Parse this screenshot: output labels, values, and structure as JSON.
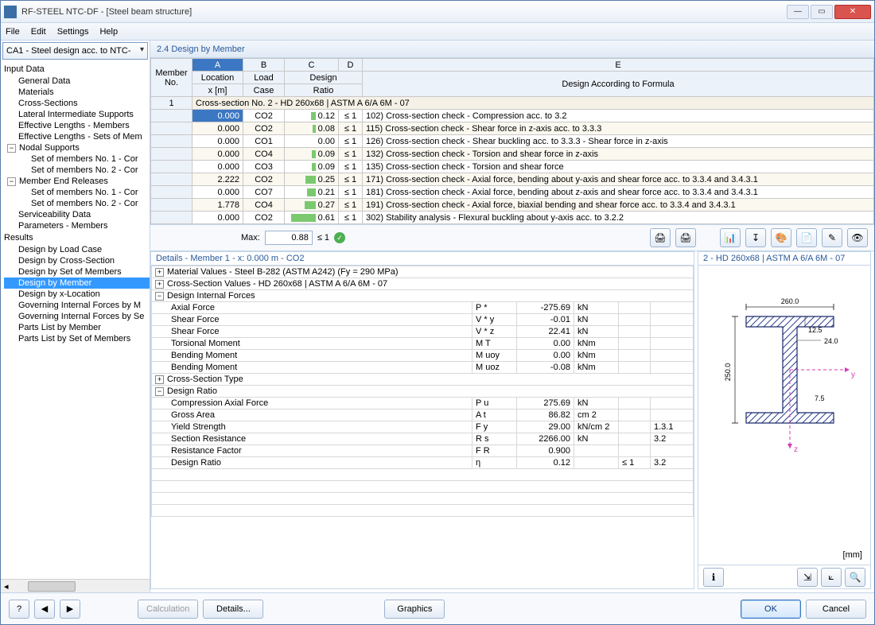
{
  "window": {
    "title": "RF-STEEL NTC-DF - [Steel beam structure]"
  },
  "menu": {
    "file": "File",
    "edit": "Edit",
    "settings": "Settings",
    "help": "Help"
  },
  "combo": "CA1 - Steel design acc. to NTC-",
  "tree": {
    "input_data": "Input Data",
    "general_data": "General Data",
    "materials": "Materials",
    "cross_sections": "Cross-Sections",
    "lateral": "Lateral Intermediate Supports",
    "eff_members": "Effective Lengths - Members",
    "eff_sets": "Effective Lengths - Sets of Mem",
    "nodal": "Nodal Supports",
    "nodal1": "Set of members No. 1 - Cor",
    "nodal2": "Set of members No. 2 - Cor",
    "mer": "Member End Releases",
    "mer1": "Set of members No. 1 - Cor",
    "mer2": "Set of members No. 2 - Cor",
    "serv": "Serviceability Data",
    "params": "Parameters - Members",
    "results": "Results",
    "r_load_case": "Design by Load Case",
    "r_cross": "Design by Cross-Section",
    "r_set": "Design by Set of Members",
    "r_member": "Design by Member",
    "r_xloc": "Design by x-Location",
    "r_gif_m": "Governing Internal Forces by M",
    "r_gif_s": "Governing Internal Forces by Se",
    "r_parts_m": "Parts List by Member",
    "r_parts_s": "Parts List by Set of Members"
  },
  "panel_title": "2.4 Design by Member",
  "grid": {
    "colA": "A",
    "colB": "B",
    "colC": "C",
    "colD": "D",
    "colE": "E",
    "h_member": "Member",
    "h_no": "No.",
    "h_location": "Location",
    "h_xm": "x [m]",
    "h_load": "Load",
    "h_case": "Case",
    "h_design": "Design",
    "h_ratio": "Ratio",
    "h_formula": "Design According to Formula",
    "section_row": "Cross-section No.  2 - HD 260x68 | ASTM A 6/A 6M - 07",
    "rownum1": "1",
    "rows": [
      {
        "x": "0.000",
        "lc": "CO2",
        "ratio": "0.12",
        "le": "≤ 1",
        "desc": "102) Cross-section check - Compression acc. to 3.2",
        "bar": 6
      },
      {
        "x": "0.000",
        "lc": "CO2",
        "ratio": "0.08",
        "le": "≤ 1",
        "desc": "115) Cross-section check - Shear force in z-axis acc. to 3.3.3",
        "bar": 4
      },
      {
        "x": "0.000",
        "lc": "CO1",
        "ratio": "0.00",
        "le": "≤ 1",
        "desc": "126) Cross-section check - Shear buckling acc. to 3.3.3 - Shear force in z-axis",
        "bar": 0
      },
      {
        "x": "0.000",
        "lc": "CO4",
        "ratio": "0.09",
        "le": "≤ 1",
        "desc": "132) Cross-section check - Torsion and shear force in z-axis",
        "bar": 5
      },
      {
        "x": "0.000",
        "lc": "CO3",
        "ratio": "0.09",
        "le": "≤ 1",
        "desc": "135) Cross-section check - Torsion and shear force",
        "bar": 5
      },
      {
        "x": "2.222",
        "lc": "CO2",
        "ratio": "0.25",
        "le": "≤ 1",
        "desc": "171) Cross-section check - Axial force, bending about y-axis and shear force acc. to 3.3.4 and 3.4.3.1",
        "bar": 13
      },
      {
        "x": "0.000",
        "lc": "CO7",
        "ratio": "0.21",
        "le": "≤ 1",
        "desc": "181) Cross-section check - Axial force, bending about z-axis and shear force acc. to 3.3.4 and 3.4.3.1",
        "bar": 11
      },
      {
        "x": "1.778",
        "lc": "CO4",
        "ratio": "0.27",
        "le": "≤ 1",
        "desc": "191) Cross-section check - Axial force, biaxial bending and shear force acc. to 3.3.4 and 3.4.3.1",
        "bar": 14
      },
      {
        "x": "0.000",
        "lc": "CO2",
        "ratio": "0.61",
        "le": "≤ 1",
        "desc": "302) Stability analysis - Flexural buckling about y-axis acc. to 3.2.2",
        "bar": 31
      }
    ]
  },
  "maxrow": {
    "label": "Max:",
    "value": "0.88",
    "le": "≤ 1"
  },
  "details": {
    "header": "Details - Member 1 - x: 0.000 m - CO2",
    "mat": "Material Values - Steel B-282 (ASTM A242) (Fy = 290 MPa)",
    "csv": "Cross-Section Values  -  HD 260x68 | ASTM A 6/A 6M - 07",
    "dif": "Design Internal Forces",
    "rows_dif": [
      {
        "name": "Axial Force",
        "sym": "P *",
        "val": "-275.69",
        "unit": "kN"
      },
      {
        "name": "Shear Force",
        "sym": "V * y",
        "val": "-0.01",
        "unit": "kN"
      },
      {
        "name": "Shear Force",
        "sym": "V * z",
        "val": "22.41",
        "unit": "kN"
      },
      {
        "name": "Torsional Moment",
        "sym": "M T",
        "val": "0.00",
        "unit": "kNm"
      },
      {
        "name": "Bending Moment",
        "sym": "M uoy",
        "val": "0.00",
        "unit": "kNm"
      },
      {
        "name": "Bending Moment",
        "sym": "M uoz",
        "val": "-0.08",
        "unit": "kNm"
      }
    ],
    "cst": "Cross-Section Type",
    "dr": "Design Ratio",
    "rows_dr": [
      {
        "name": "Compression Axial Force",
        "sym": "P u",
        "val": "275.69",
        "unit": "kN",
        "lim": "",
        "ref": ""
      },
      {
        "name": "Gross Area",
        "sym": "A t",
        "val": "86.82",
        "unit": "cm 2",
        "lim": "",
        "ref": ""
      },
      {
        "name": "Yield Strength",
        "sym": "F y",
        "val": "29.00",
        "unit": "kN/cm 2",
        "lim": "",
        "ref": "1.3.1"
      },
      {
        "name": "Section Resistance",
        "sym": "R s",
        "val": "2266.00",
        "unit": "kN",
        "lim": "",
        "ref": "3.2"
      },
      {
        "name": "Resistance Factor",
        "sym": "F R",
        "val": "0.900",
        "unit": "",
        "lim": "",
        "ref": ""
      },
      {
        "name": "Design Ratio",
        "sym": "η",
        "val": "0.12",
        "unit": "",
        "lim": "≤ 1",
        "ref": "3.2"
      }
    ]
  },
  "diagram": {
    "title": "2 - HD 260x68 | ASTM A 6/A 6M - 07",
    "width": "260.0",
    "tf": "12.5",
    "tw": "24.0",
    "height": "250.0",
    "r": "7.5",
    "mm": "[mm]",
    "y": "y",
    "z": "z"
  },
  "footer": {
    "calculation": "Calculation",
    "details": "Details...",
    "graphics": "Graphics",
    "ok": "OK",
    "cancel": "Cancel"
  }
}
